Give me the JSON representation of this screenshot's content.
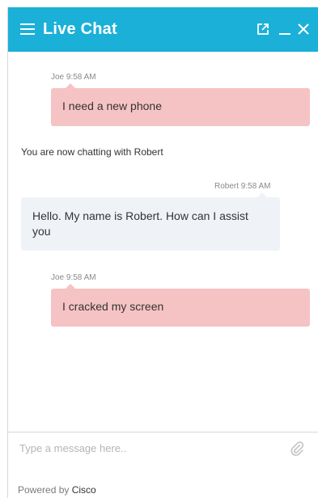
{
  "header": {
    "title": "Live Chat",
    "menu_icon": "hamburger-menu-icon",
    "popout_icon": "popout-icon",
    "minimize_icon": "minimize-icon",
    "close_icon": "close-icon",
    "color": "#1ab0d8"
  },
  "messages": [
    {
      "type": "user",
      "sender": "Joe",
      "time": "9:58 AM",
      "meta": "Joe 9:58 AM",
      "text": "I need a new phone"
    },
    {
      "type": "system",
      "text": "You are now chatting with Robert"
    },
    {
      "type": "agent",
      "sender": "Robert",
      "time": "9:58 AM",
      "meta": "Robert 9:58 AM",
      "text": "Hello. My name is Robert. How can I assist you"
    },
    {
      "type": "user",
      "sender": "Joe",
      "time": "9:58 AM",
      "meta": "Joe 9:58 AM",
      "text": "I cracked my screen"
    }
  ],
  "composer": {
    "placeholder": "Type a message here..",
    "value": "",
    "attach_icon": "paperclip-icon"
  },
  "footer": {
    "powered_label": "Powered by",
    "brand": "Cisco"
  },
  "colors": {
    "user_bubble": "#f6c3c4",
    "agent_bubble": "#eff3f8"
  }
}
